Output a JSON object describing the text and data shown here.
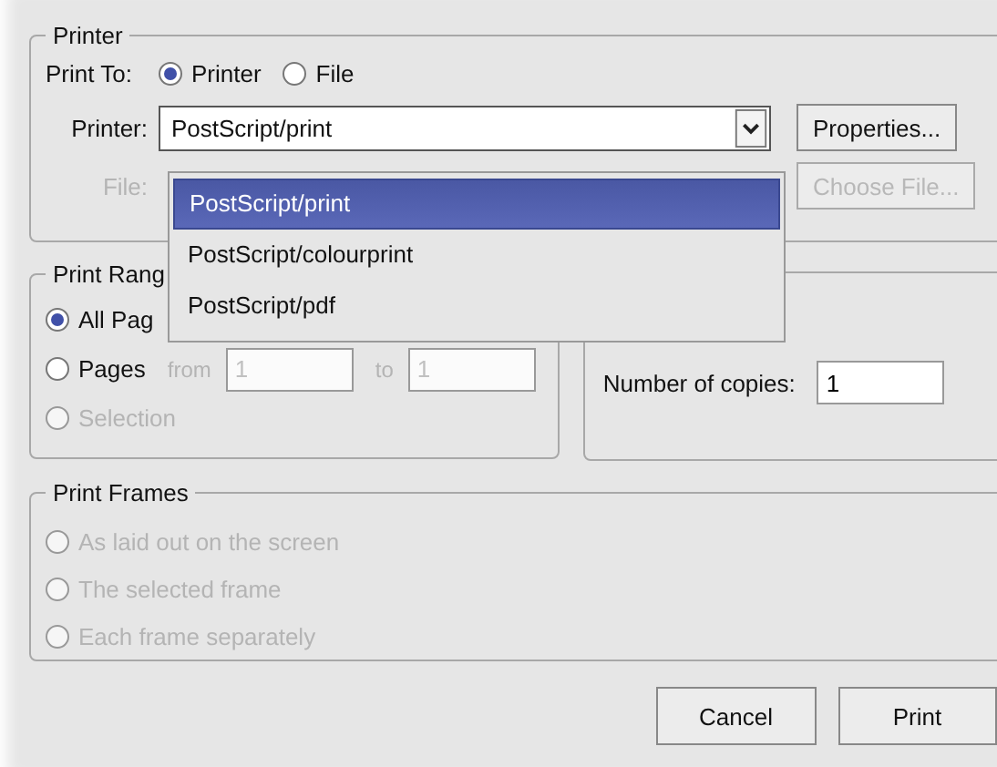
{
  "printer_group": {
    "title": "Printer",
    "print_to_label": "Print To:",
    "destinations": [
      {
        "label": "Printer",
        "selected": true
      },
      {
        "label": "File",
        "selected": false
      }
    ],
    "printer_label": "Printer:",
    "printer_value": "PostScript/print",
    "properties_button": "Properties...",
    "file_label": "File:",
    "file_disabled": true,
    "choose_file_button": "Choose File..."
  },
  "printer_dropdown": {
    "options": [
      {
        "label": "PostScript/print",
        "selected": true
      },
      {
        "label": "PostScript/colourprint",
        "selected": false
      },
      {
        "label": "PostScript/pdf",
        "selected": false
      }
    ]
  },
  "print_range": {
    "title": "Print Rang",
    "options": [
      {
        "label": "All Pag",
        "selected": true,
        "disabled": false
      },
      {
        "label": "Pages",
        "selected": false,
        "disabled": false
      },
      {
        "label": "Selection",
        "selected": false,
        "disabled": true
      }
    ],
    "from_label": "from",
    "from_value": "1",
    "to_label": "to",
    "to_value": "1",
    "range_disabled": true
  },
  "copies": {
    "label": "Number of copies:",
    "value": "1"
  },
  "print_frames": {
    "title": "Print Frames",
    "options": [
      {
        "label": "As laid out on the screen",
        "selected": false,
        "disabled": true
      },
      {
        "label": "The selected frame",
        "selected": false,
        "disabled": true
      },
      {
        "label": "Each frame separately",
        "selected": false,
        "disabled": true
      }
    ]
  },
  "buttons": [
    "Cancel",
    "Print"
  ]
}
